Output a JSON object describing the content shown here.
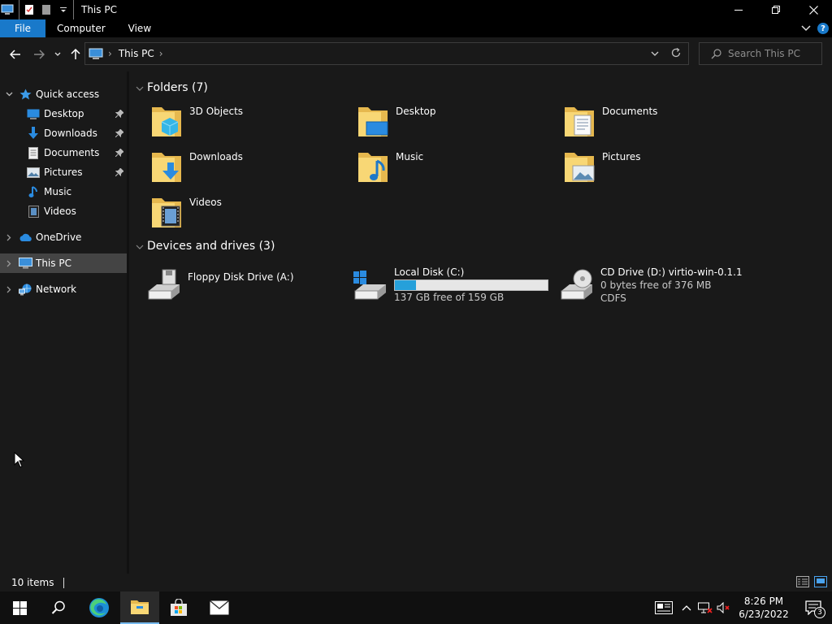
{
  "window": {
    "title": "This PC",
    "minimize_label": "—",
    "maximize_label": "❐",
    "close_label": "✕"
  },
  "ribbon": {
    "tabs": [
      "File",
      "Computer",
      "View"
    ]
  },
  "address": {
    "path": "This PC",
    "search_placeholder": "Search This PC"
  },
  "nav": {
    "quick_access": "Quick access",
    "items": [
      {
        "label": "Desktop",
        "pinned": true
      },
      {
        "label": "Downloads",
        "pinned": true
      },
      {
        "label": "Documents",
        "pinned": true
      },
      {
        "label": "Pictures",
        "pinned": true
      },
      {
        "label": "Music",
        "pinned": false
      },
      {
        "label": "Videos",
        "pinned": false
      }
    ],
    "onedrive": "OneDrive",
    "this_pc": "This PC",
    "network": "Network"
  },
  "folders": {
    "header": "Folders (7)",
    "items": [
      "3D Objects",
      "Desktop",
      "Documents",
      "Downloads",
      "Music",
      "Pictures",
      "Videos"
    ]
  },
  "drives": {
    "header": "Devices and drives (3)",
    "items": [
      {
        "name": "Floppy Disk Drive (A:)"
      },
      {
        "name": "Local Disk (C:)",
        "free": "137 GB free of 159 GB",
        "used_fraction": 0.14
      },
      {
        "name": "CD Drive (D:) virtio-win-0.1.1",
        "free": "0 bytes free of 376 MB",
        "fs": "CDFS"
      }
    ]
  },
  "status": {
    "items_count": "10 items"
  },
  "taskbar": {
    "time": "8:26 PM",
    "date": "6/23/2022",
    "notifications": "3"
  },
  "colors": {
    "accent": "#1979ca",
    "progress": "#26a0da",
    "folder": "#f8d775"
  }
}
